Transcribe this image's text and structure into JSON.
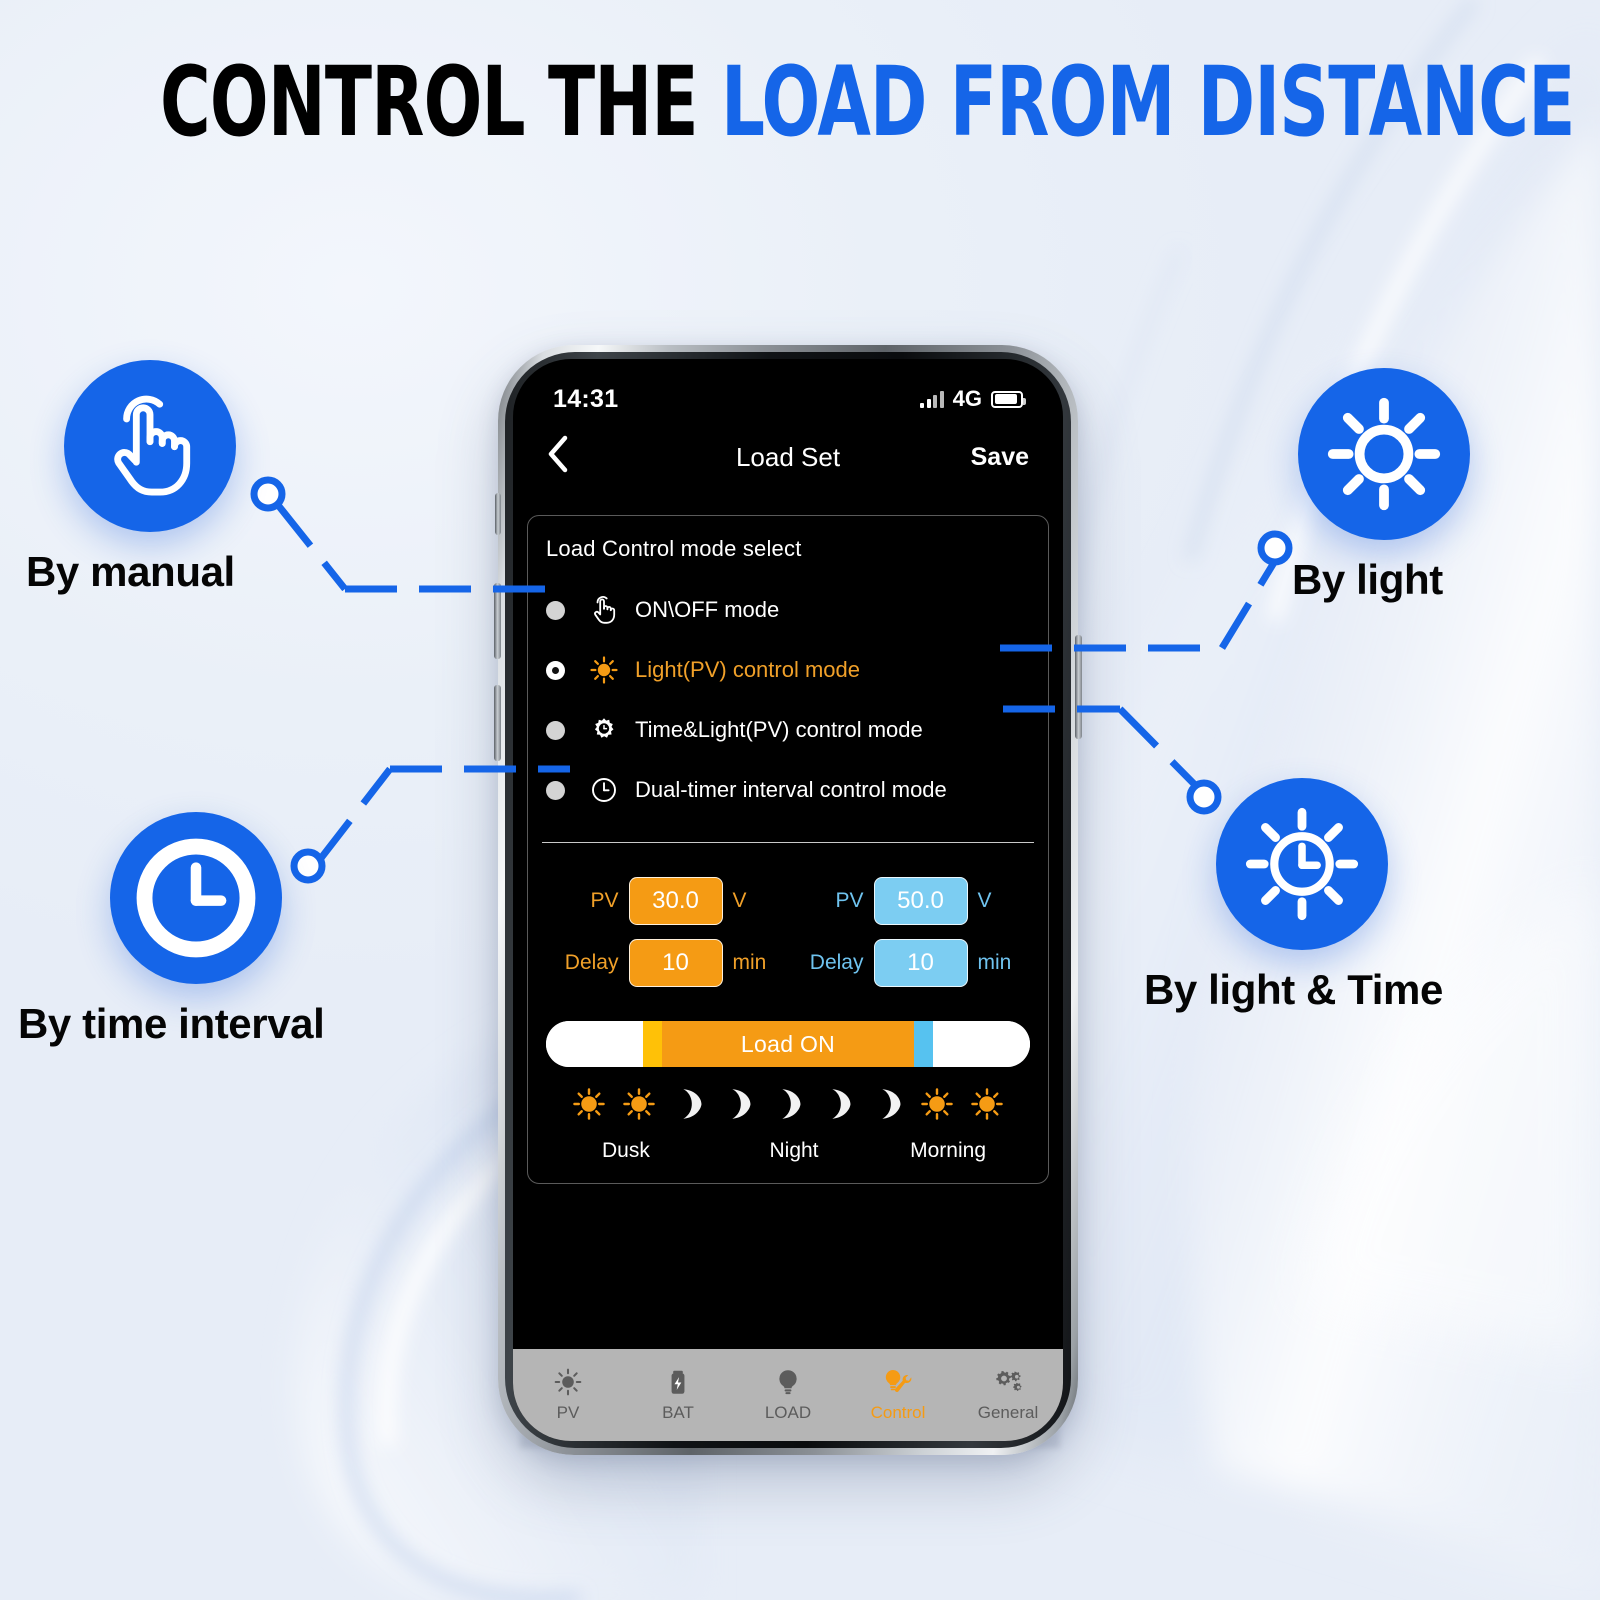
{
  "heading": {
    "part1": "CONTROL THE ",
    "part2": "LOAD FROM DISTANCE"
  },
  "colors": {
    "brand_blue": "#1565e8",
    "accent_orange": "#f59b14",
    "accent_light_blue": "#7ccdf2",
    "background": "#eef2f9"
  },
  "callouts": [
    {
      "id": "by-manual",
      "label": "By manual",
      "icon": "tap-hand-icon"
    },
    {
      "id": "by-time-interval",
      "label": "By time interval",
      "icon": "clock-icon"
    },
    {
      "id": "by-light",
      "label": "By light",
      "icon": "sun-icon"
    },
    {
      "id": "by-light-time",
      "label": "By light & Time",
      "icon": "sun-clock-icon"
    }
  ],
  "phone": {
    "status_bar": {
      "time": "14:31",
      "network": "4G",
      "signal_icon": "signal-bars-icon",
      "battery_icon": "battery-icon"
    },
    "navbar": {
      "back_icon": "chevron-left-icon",
      "title": "Load Set",
      "save_label": "Save"
    },
    "card": {
      "title": "Load Control mode select",
      "modes": [
        {
          "label": "ON\\OFF mode",
          "icon": "tap-hand-icon",
          "selected": false
        },
        {
          "label": "Light(PV) control mode",
          "icon": "sun-icon",
          "selected": true
        },
        {
          "label": "Time&Light(PV) control mode",
          "icon": "sun-gear-icon",
          "selected": false
        },
        {
          "label": "Dual-timer interval control mode",
          "icon": "clock-icon",
          "selected": false
        }
      ],
      "settings": {
        "left": {
          "pv_label": "PV",
          "pv_value": "30.0",
          "pv_unit": "V",
          "delay_label": "Delay",
          "delay_value": "10",
          "delay_unit": "min"
        },
        "right": {
          "pv_label": "PV",
          "pv_value": "50.0",
          "pv_unit": "V",
          "delay_label": "Delay",
          "delay_value": "10",
          "delay_unit": "min"
        }
      },
      "loadbar": {
        "text": "Load ON"
      },
      "phase_icons": [
        "sun-icon",
        "sun-icon",
        "moon-icon",
        "moon-icon",
        "moon-icon",
        "moon-icon",
        "moon-icon",
        "sun-icon",
        "sun-icon"
      ],
      "phase_labels": [
        "Dusk",
        "Night",
        "Morning"
      ]
    },
    "tabbar": [
      {
        "label": "PV",
        "icon": "sun-icon",
        "active": false
      },
      {
        "label": "BAT",
        "icon": "battery-bolt-icon",
        "active": false
      },
      {
        "label": "LOAD",
        "icon": "bulb-icon",
        "active": false
      },
      {
        "label": "Control",
        "icon": "bulb-wrench-icon",
        "active": true
      },
      {
        "label": "General",
        "icon": "gears-icon",
        "active": false
      }
    ]
  }
}
